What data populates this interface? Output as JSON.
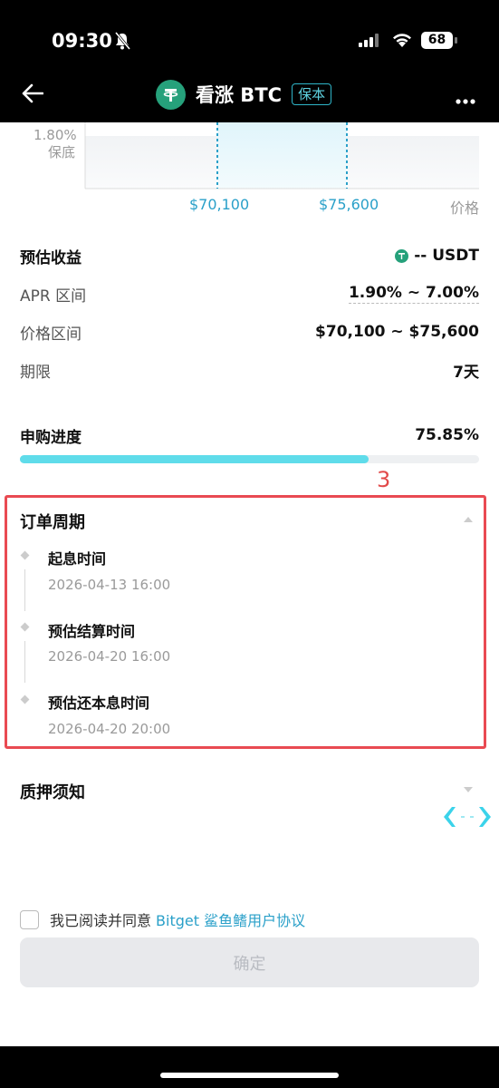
{
  "status_bar": {
    "time": "09:30",
    "battery": "68"
  },
  "header": {
    "title": "看涨 BTC",
    "badge": "保本"
  },
  "chart": {
    "y_value": "1.80%",
    "y_caption": "保底",
    "x_low": "$70,100",
    "x_high": "$75,600",
    "x_axis_label": "价格"
  },
  "details": {
    "estimated_return_label": "预估收益",
    "estimated_return_value": "-- USDT",
    "apr_label": "APR 区间",
    "apr_value": "1.90% ~ 7.00%",
    "price_range_label": "价格区间",
    "price_range_value": "$70,100 ~ $75,600",
    "term_label": "期限",
    "term_value": "7天"
  },
  "progress": {
    "label": "申购进度",
    "value_text": "75.85%",
    "fraction": 0.7585
  },
  "annotation": "3",
  "order_cycle": {
    "title": "订单周期",
    "steps": [
      {
        "label": "起息时间",
        "time": "2026-04-13 16:00"
      },
      {
        "label": "预估结算时间",
        "time": "2026-04-20 16:00"
      },
      {
        "label": "预估还本息时间",
        "time": "2026-04-20 20:00"
      }
    ]
  },
  "pledge": {
    "title": "质押须知"
  },
  "agreement": {
    "text": "我已阅读并同意",
    "link": "Bitget 鲨鱼鳍用户协议"
  },
  "confirm_label": "确定",
  "colors": {
    "accent": "#5fdcea",
    "link": "#2aa0c9",
    "tether": "#26a17b",
    "highlight_box": "#e94a52"
  }
}
